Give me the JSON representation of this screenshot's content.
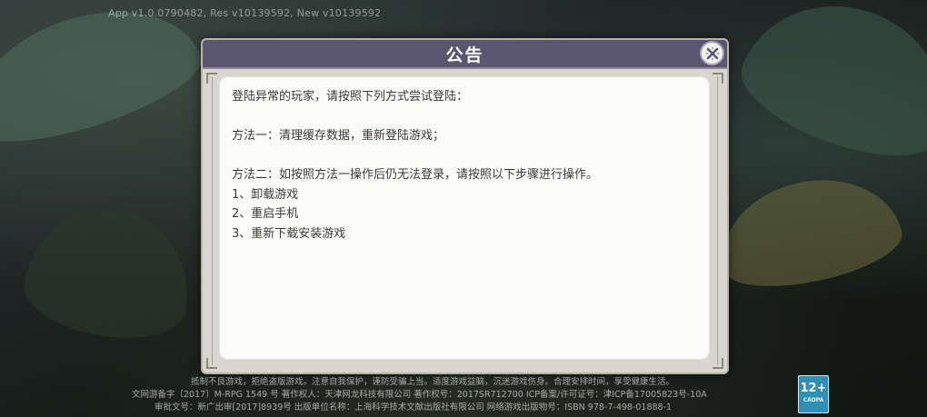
{
  "version_text": "App v1.0.0790482, Res v10139592, New v10139592",
  "dialog": {
    "title": "公告",
    "lines": [
      "登陆异常的玩家，请按照下列方式尝试登陆：",
      "",
      "方法一：清理缓存数据，重新登陆游戏；",
      "",
      "方法二：如按照方法一操作后仍无法登录，请按照以下步骤进行操作。",
      "1、卸载游戏",
      "2、重启手机",
      "3、重新下载安装游戏"
    ],
    "close_icon": "close-icon"
  },
  "footer": {
    "line1": "抵制不良游戏，拒绝盗版游戏。注意自我保护，谨防受骗上当。适度游戏益脑，沉迷游戏伤身。合理安排时间，享受健康生活。",
    "line2": "文网游备字〔2017〕M-RPG 1549 号 著作权人：天津网龙科技有限公司 著作权号：2017SR712700 ICP备案/许可证号：津ICP备17005823号-10A",
    "line3": "审批文号：新广出审[2017]8939号 出版单位名称：上海科学技术文献出版社有限公司 网络游戏出版物号：ISBN 978-7-498-01888-1"
  },
  "age_badge": {
    "rating": "12+",
    "label": "CADPA"
  },
  "colors": {
    "header": "#5a5670",
    "panel": "#fbfbfa",
    "frame": "#d9d6d0",
    "text": "#3c3838"
  }
}
